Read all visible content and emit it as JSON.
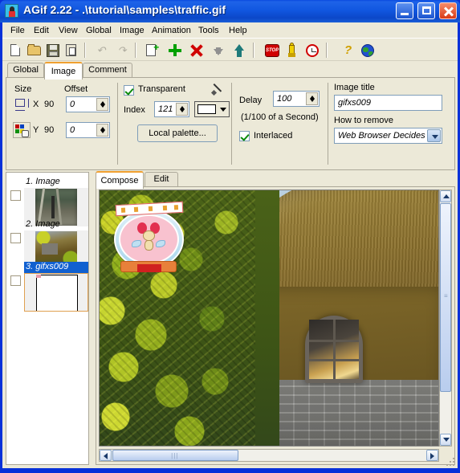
{
  "window": {
    "title": "AGif 2.22 - .\\tutorial\\samples\\traffic.gif",
    "app_icon": "agif-app-icon",
    "minimize_label": "Minimize",
    "maximize_label": "Maximize",
    "close_label": "Close",
    "titlebar_color": "#0a4ae0",
    "client_color": "#ece9d8"
  },
  "menu": {
    "items": [
      {
        "label": "File"
      },
      {
        "label": "Edit"
      },
      {
        "label": "View"
      },
      {
        "label": "Global"
      },
      {
        "label": "Image"
      },
      {
        "label": "Animation"
      },
      {
        "label": "Tools"
      },
      {
        "label": "Help"
      }
    ]
  },
  "toolbar": {
    "buttons": [
      {
        "name": "new-file-icon",
        "tip": "New"
      },
      {
        "name": "open-file-icon",
        "tip": "Open"
      },
      {
        "name": "save-file-icon",
        "tip": "Save"
      },
      {
        "name": "save-as-icon",
        "tip": "Save As"
      },
      {
        "name": "undo-icon",
        "tip": "Undo",
        "disabled": true
      },
      {
        "name": "redo-icon",
        "tip": "Redo",
        "disabled": true
      },
      {
        "name": "insert-image-icon",
        "tip": "Insert Image"
      },
      {
        "name": "add-image-icon",
        "tip": "Add Image"
      },
      {
        "name": "delete-image-icon",
        "tip": "Delete Image"
      },
      {
        "name": "move-down-icon",
        "tip": "Move Down",
        "disabled": true
      },
      {
        "name": "move-up-icon",
        "tip": "Move Up"
      },
      {
        "name": "stop-icon",
        "tip": "Stop"
      },
      {
        "name": "run-icon",
        "tip": "Run Animation"
      },
      {
        "name": "timer-icon",
        "tip": "Timer"
      },
      {
        "name": "help-icon",
        "tip": "Help"
      },
      {
        "name": "web-icon",
        "tip": "Web"
      }
    ]
  },
  "property_tabs": {
    "items": [
      {
        "label": "Global",
        "active": false
      },
      {
        "label": "Image",
        "active": true
      },
      {
        "label": "Comment",
        "active": false
      }
    ]
  },
  "properties": {
    "size": {
      "group_label": "Size",
      "x_label": "X",
      "x_value": "90",
      "y_label": "Y",
      "y_value": "90",
      "dimension_icon": "dimension-icon",
      "palette_icon": "palette-hand-icon"
    },
    "offset": {
      "group_label": "Offset",
      "x_value": "0",
      "y_value": "0"
    },
    "transparent": {
      "checkbox_label": "Transparent",
      "checked": true,
      "index_label": "Index",
      "index_value": "121",
      "eyedropper_icon": "eyedropper-icon",
      "swatch_color": "#ffffff",
      "local_palette_label": "Local palette..."
    },
    "delay": {
      "label": "Delay",
      "value": "100",
      "unit_note": "(1/100 of a Second)",
      "interlaced_label": "Interlaced",
      "interlaced_checked": true
    },
    "image_title": {
      "label": "Image title",
      "value": "gifxs009"
    },
    "how_to_remove": {
      "label": "How to remove",
      "value": "Web Browser Decides"
    }
  },
  "frame_list": {
    "frames": [
      {
        "label": "1. Image",
        "selected": false,
        "checked": false,
        "thumb": "railway-track-thumb"
      },
      {
        "label": "2. Image",
        "selected": false,
        "checked": false,
        "thumb": "cottage-thumb"
      },
      {
        "label": "3. gifxs009",
        "selected": true,
        "checked": false,
        "thumb": "blank-white-thumb"
      }
    ]
  },
  "canvas_tabs": {
    "items": [
      {
        "label": "Compose",
        "active": true
      },
      {
        "label": "Edit",
        "active": false
      }
    ]
  },
  "canvas": {
    "image_name": "cottage-scene-with-sticker",
    "sticker_name": "pink-angel-dog-sticker",
    "v_scrollbar": {
      "name": "vertical-scrollbar",
      "thumb_top_pct": 0,
      "thumb_height_pct": 78
    },
    "h_scrollbar": {
      "name": "horizontal-scrollbar",
      "thumb_left_pct": 0,
      "thumb_width_pct": 37
    }
  }
}
